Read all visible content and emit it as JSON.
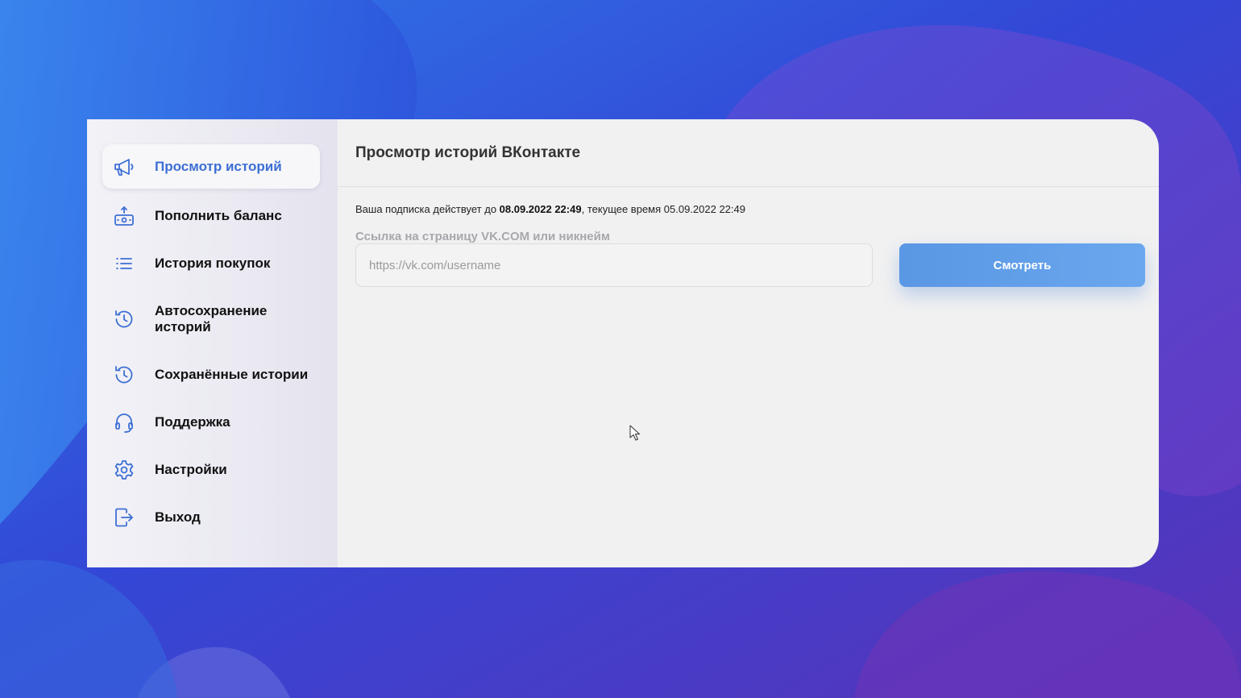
{
  "sidebar": {
    "items": [
      {
        "label": "Просмотр историй",
        "icon": "megaphone-icon",
        "active": true
      },
      {
        "label": "Пополнить баланс",
        "icon": "cash-register-icon"
      },
      {
        "label": "История покупок",
        "icon": "list-icon"
      },
      {
        "label": "Автосохранение\nисторий",
        "icon": "history-icon"
      },
      {
        "label": "Сохранённые истории",
        "icon": "history-icon"
      },
      {
        "label": "Поддержка",
        "icon": "headset-icon"
      },
      {
        "label": "Настройки",
        "icon": "gear-icon"
      },
      {
        "label": "Выход",
        "icon": "logout-icon"
      }
    ]
  },
  "main": {
    "title": "Просмотр историй ВКонтакте",
    "subscription": {
      "prefix": "Ваша подписка действует до ",
      "until": "08.09.2022 22:49",
      "suffix": ", текущее время 05.09.2022 22:49"
    },
    "field_label": "Ссылка на страницу VK.COM или никнейм",
    "input": {
      "value": "",
      "placeholder": "https://vk.com/username"
    },
    "button_label": "Смотреть"
  },
  "colors": {
    "accent": "#3d6fd4",
    "button": "#5a97e4",
    "background_blue": "#3a3fd6",
    "background_purple": "#5a3fc0"
  }
}
